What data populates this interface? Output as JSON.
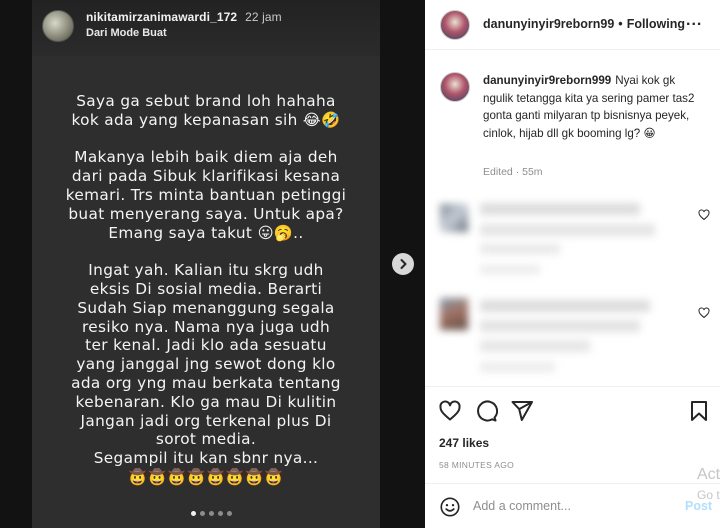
{
  "story": {
    "username": "nikitamirzanimawardi_172",
    "time": "22 jam",
    "subtitle": "Dari Mode Buat",
    "text": "Saya ga sebut brand loh hahaha\nkok ada yang kepanasan sih 😂🤣\n\nMakanya lebih baik diem aja deh\ndari pada Sibuk klarifikasi kesana\nkemari. Trs minta bantuan petinggi\nbuat menyerang saya. Untuk apa?\nEmang saya takut 😛🥱..\n\nIngat yah. Kalian itu skrg udh\neksis Di sosial media. Berarti\nSudah Siap menanggung segala\nresiko nya. Nama nya juga udh\nter kenal. Jadi klo ada sesuatu\nyang janggal jng sewot dong klo\nada org yng mau berkata tentang\nkebenaran. Klo ga mau Di kulitin\nJangan jadi org terkenal plus Di\nsorot media.\nSegampil itu kan sbnr nya...\n🤠🤠🤠🤠🤠🤠🤠🤠",
    "dots_total": 5,
    "dots_active": 0
  },
  "post": {
    "header": {
      "username": "danunyinyir9reborn99",
      "separator": "•",
      "follow_status": "Following",
      "more_label": "..."
    },
    "caption": {
      "username": "danunyinyir9reborn999",
      "text": "Nyai kok gk ngulik tetangga kita ya sering pamer tas2 gonta ganti milyaran tp bisnisnya peyek, cinlok, hijab dll gk booming lg? 😀",
      "meta": "Edited · 55m"
    },
    "likes": "247 likes",
    "time_ago": "58 MINUTES AGO",
    "comment": {
      "placeholder": "Add a comment...",
      "post_label": "Post"
    }
  },
  "watermark": {
    "line1": "Act",
    "line2": "Go t"
  },
  "icons": [
    "heart-icon",
    "comment-icon",
    "share-icon",
    "bookmark-icon",
    "smile-icon",
    "chevron-right-icon",
    "more-icon"
  ],
  "colors": {
    "story_bg": "#2e2e2e",
    "post_link": "#b2dffc",
    "muted": "#8e8e8e"
  }
}
